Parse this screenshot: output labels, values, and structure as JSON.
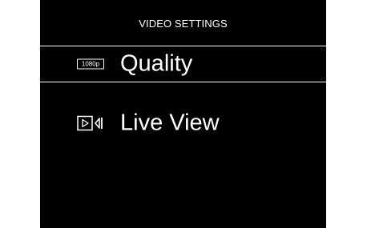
{
  "menu": {
    "title": "VIDEO SETTINGS",
    "items": [
      {
        "icon": "resolution-1080p-icon",
        "icon_text": "1080p",
        "label": "Quality",
        "selected": true
      },
      {
        "icon": "live-view-icon",
        "label": "Live View",
        "selected": false
      }
    ]
  },
  "colors": {
    "background": "#000000",
    "text": "#ffffff",
    "selection_border": "#ffffff",
    "page_background": "#ffffff"
  }
}
